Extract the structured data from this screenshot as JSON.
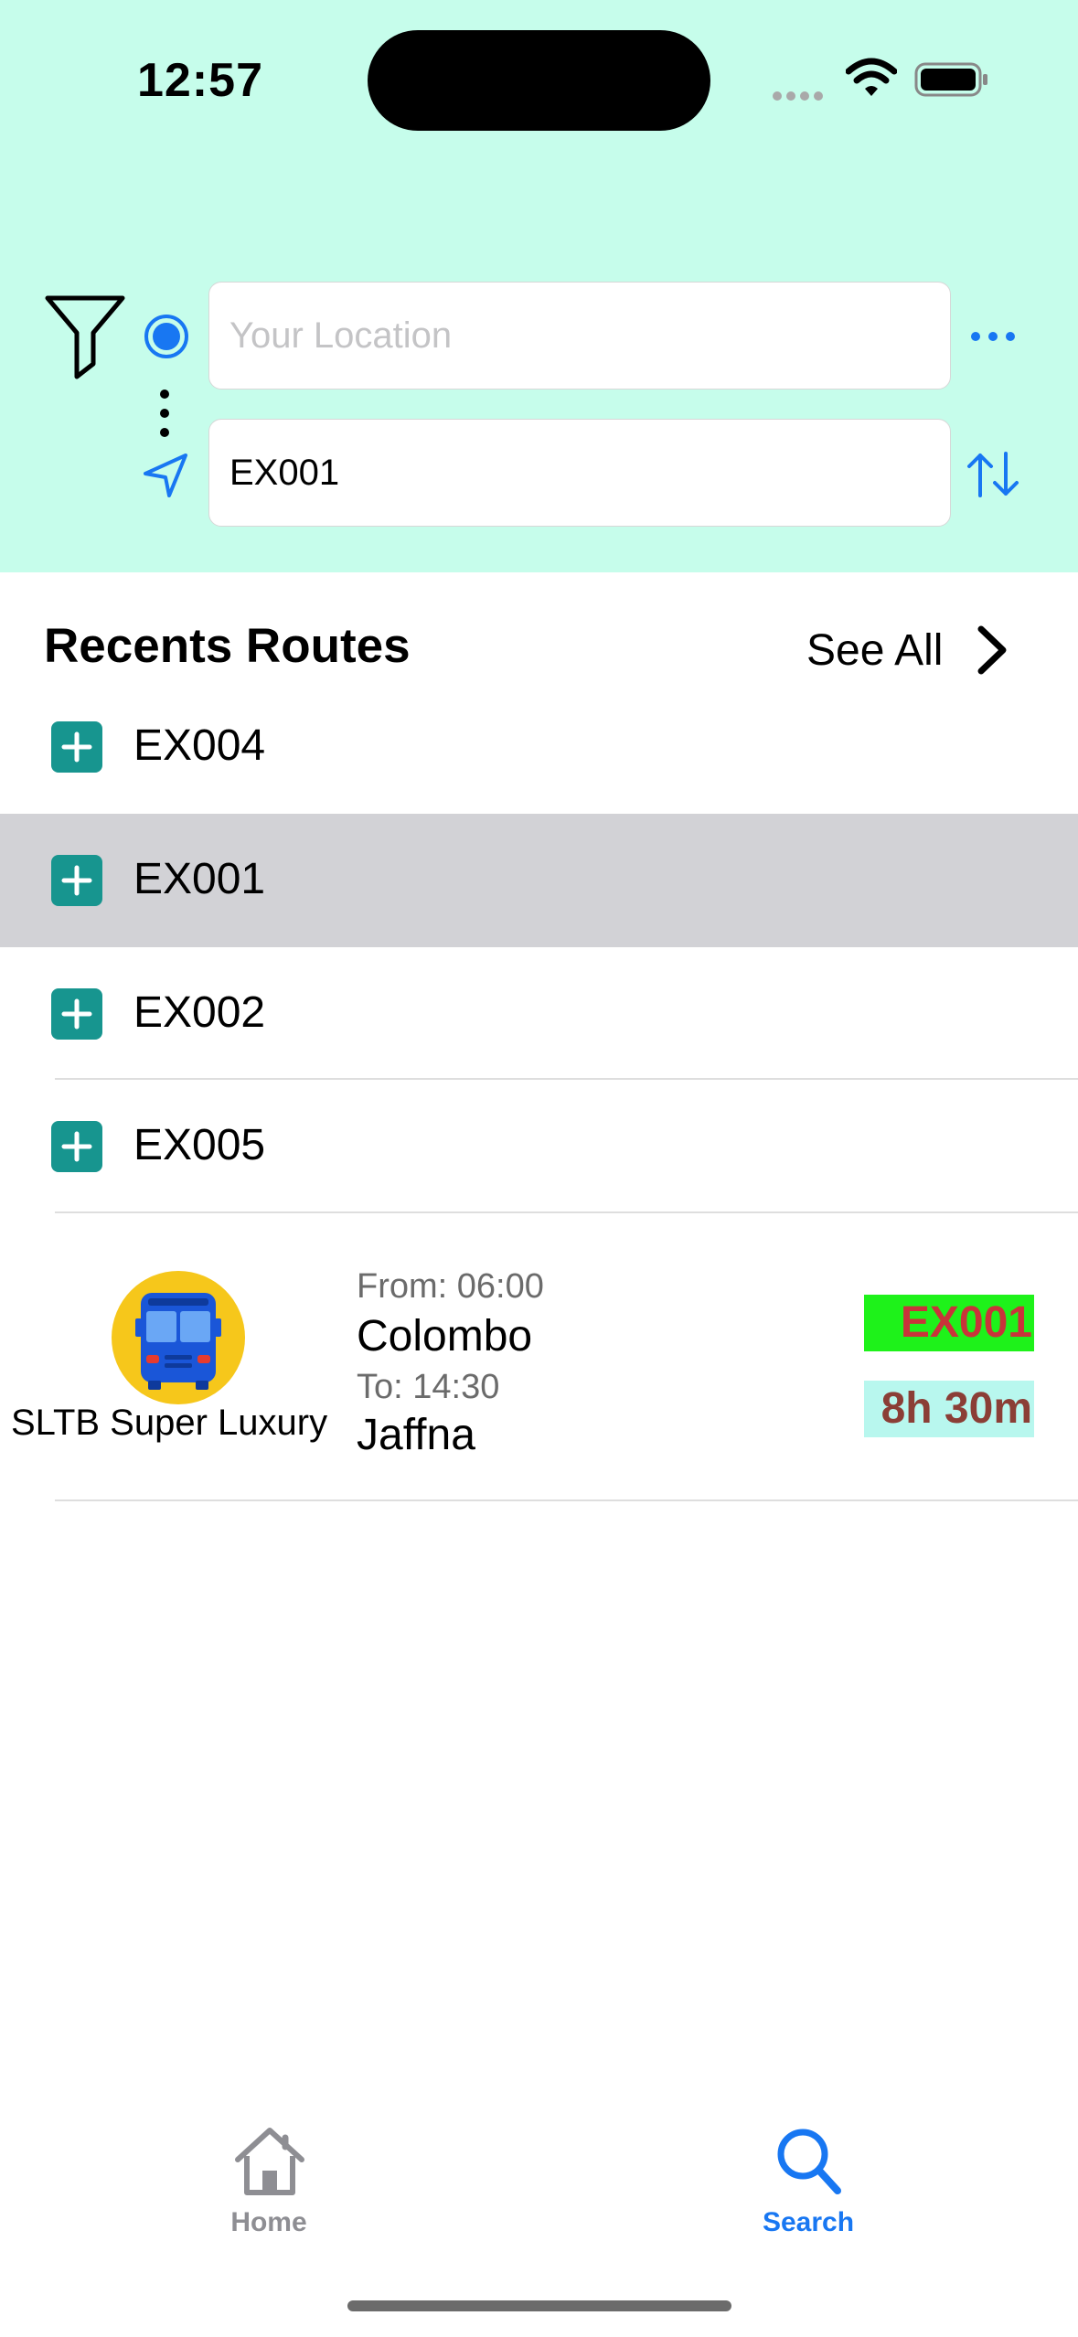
{
  "status_bar": {
    "time": "12:57"
  },
  "search": {
    "location_placeholder": "Your Location",
    "destination_value": "EX001"
  },
  "recents": {
    "title": "Recents Routes",
    "see_all_label": "See All",
    "items": [
      {
        "label": "EX004",
        "selected": false
      },
      {
        "label": "EX001",
        "selected": true
      },
      {
        "label": "EX002",
        "selected": false
      },
      {
        "label": "EX005",
        "selected": false
      }
    ]
  },
  "result": {
    "operator": "SLTB Super Luxury",
    "from_time": "From: 06:00",
    "from_city": "Colombo",
    "to_time": "To: 14:30",
    "to_city": "Jaffna",
    "route_code": "EX001",
    "duration": "8h 30m"
  },
  "tab_bar": {
    "tabs": [
      {
        "label": "Home",
        "icon": "home-icon",
        "active": false
      },
      {
        "label": "Search",
        "icon": "search-icon",
        "active": true
      }
    ]
  },
  "colors": {
    "header_bg": "#c6fdeb",
    "accent": "#1877f2",
    "add_icon": "#17958f",
    "selected_row": "#d2d2d6",
    "route_badge_bg": "#1ef21a",
    "route_badge_text": "#c8343a",
    "duration_badge_bg": "#b8f7ee",
    "duration_badge_text": "#8b3e36"
  }
}
